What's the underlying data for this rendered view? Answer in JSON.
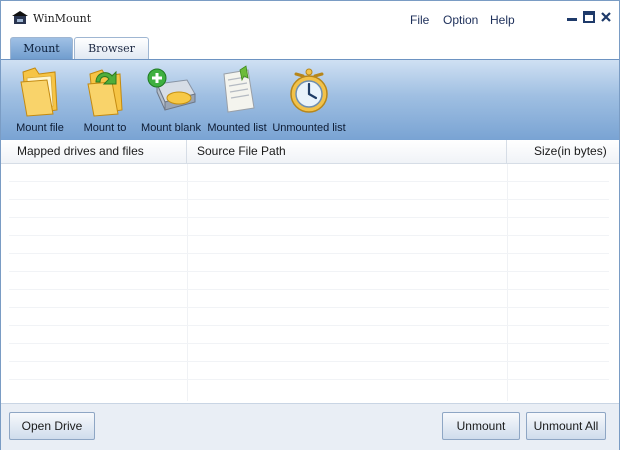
{
  "window": {
    "title": "WinMount"
  },
  "menu": {
    "file": "File",
    "option": "Option",
    "help": "Help"
  },
  "window_controls": [
    "minimize-icon",
    "maximize-icon",
    "close-icon"
  ],
  "tabs": [
    {
      "label": "Mount",
      "active": true
    },
    {
      "label": "Browser",
      "active": false
    }
  ],
  "toolbar": {
    "items": [
      {
        "label": "Mount file",
        "icon": "folder-icon"
      },
      {
        "label": "Mount to",
        "icon": "folder-arrow-icon"
      },
      {
        "label": "Mount blank",
        "icon": "disk-add-icon"
      },
      {
        "label": "Mounted list",
        "icon": "document-list-icon"
      },
      {
        "label": "Unmounted list",
        "icon": "clock-icon"
      }
    ]
  },
  "table": {
    "columns": [
      "Mapped drives and files",
      "Source File Path",
      "Size(in bytes)"
    ],
    "rows": []
  },
  "footer": {
    "open_drive": "Open Drive",
    "unmount": "Unmount",
    "unmount_all": "Unmount All"
  },
  "colors": {
    "toolbar_top": "#cfe0f3",
    "toolbar_bottom": "#79a3d3",
    "accent": "#6f9ccd"
  }
}
